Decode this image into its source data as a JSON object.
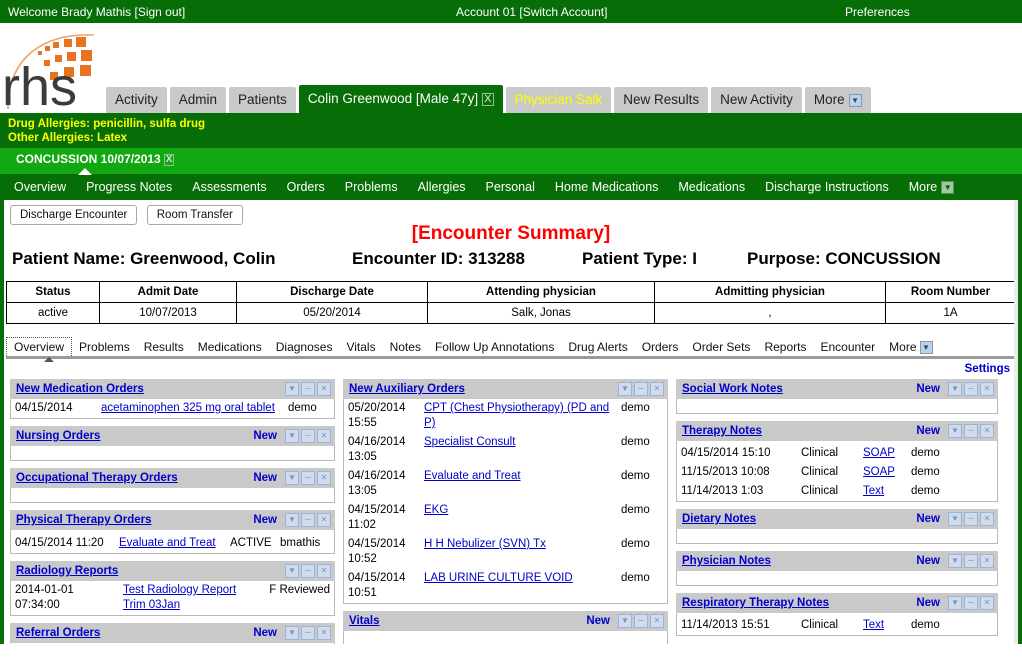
{
  "utilbar": {
    "welcome": "Welcome Brady Mathis [Sign out]",
    "account": "Account 01 [Switch Account]",
    "preferences": "Preferences"
  },
  "logo": {
    "text": "rhs"
  },
  "tabs": [
    {
      "label": "Activity",
      "state": "normal"
    },
    {
      "label": "Admin",
      "state": "normal"
    },
    {
      "label": "Patients",
      "state": "normal"
    },
    {
      "label": "Colin Greenwood [Male 47y]",
      "state": "active",
      "close": "X"
    },
    {
      "label": "Physician Salk",
      "state": "warn"
    },
    {
      "label": "New Results",
      "state": "normal"
    },
    {
      "label": "New Activity",
      "state": "normal"
    },
    {
      "label": "More",
      "state": "dropdown",
      "caret": "▼"
    }
  ],
  "allergies": {
    "drug": "Drug Allergies: penicillin, sulfa drug",
    "other": "Other Allergies: Latex"
  },
  "encounter_chip": {
    "label": "CONCUSSION 10/07/2013",
    "close": "X"
  },
  "subnav": {
    "items": [
      "Overview",
      "Progress Notes",
      "Assessments",
      "Orders",
      "Problems",
      "Allergies",
      "Personal",
      "Home Medications",
      "Medications",
      "Discharge Instructions"
    ],
    "more": "More",
    "more_caret": "▼"
  },
  "actions": {
    "discharge": "Discharge Encounter",
    "room_transfer": "Room Transfer"
  },
  "summary": {
    "title": "[Encounter Summary]",
    "patient_name": "Patient Name: Greenwood, Colin",
    "encounter_id": "Encounter ID: 313288",
    "patient_type": "Patient Type: I",
    "purpose": "Purpose: CONCUSSION"
  },
  "encounter_table": {
    "headers": [
      "Status",
      "Admit Date",
      "Discharge Date",
      "Attending physician",
      "Admitting physician",
      "Room Number"
    ],
    "row": [
      "active",
      "10/07/2013",
      "05/20/2014",
      "Salk, Jonas",
      ",",
      "1A"
    ]
  },
  "tabstrip": {
    "items": [
      "Overview",
      "Problems",
      "Results",
      "Medications",
      "Diagnoses",
      "Vitals",
      "Notes",
      "Follow Up Annotations",
      "Drug Alerts",
      "Orders",
      "Order Sets",
      "Reports",
      "Encounter"
    ],
    "more": "More",
    "more_caret": "▼",
    "selected": "Overview"
  },
  "settings_link": "Settings",
  "icons": {
    "collapse_caret": "▼",
    "minimize": "─",
    "close": "✕"
  },
  "columns": {
    "left": [
      {
        "title": "New Medication Orders",
        "new": null,
        "rows": [
          {
            "date": "04/15/2014",
            "link": "acetaminophen 325 mg oral tablet",
            "end": "demo"
          }
        ]
      },
      {
        "title": "Nursing Orders",
        "new": "New",
        "rows": []
      },
      {
        "title": "Occupational Therapy Orders",
        "new": "New",
        "rows": []
      },
      {
        "title": "Physical Therapy Orders",
        "new": "New",
        "rows": [
          {
            "date": "04/15/2014 11:20",
            "link": "Evaluate and Treat",
            "mid": "ACTIVE",
            "end": "bmathis"
          }
        ]
      },
      {
        "title": "Radiology Reports",
        "new": null,
        "rows": [
          {
            "date": "2014-01-01",
            "link": "Test Radiology Report",
            "end": "F Reviewed"
          },
          {
            "date": "07:34:00",
            "link": "Trim 03Jan",
            "end": ""
          }
        ]
      },
      {
        "title": "Referral Orders",
        "new": "New",
        "rows": []
      }
    ],
    "middle": [
      {
        "title": "New Auxiliary Orders",
        "new": null,
        "rows": [
          {
            "date": "05/20/2014 15:55",
            "link": "CPT (Chest Physiotherapy) (PD and P)",
            "end": "demo"
          },
          {
            "date": "04/16/2014 13:05",
            "link": "Specialist Consult",
            "end": "demo"
          },
          {
            "date": "04/16/2014 13:05",
            "link": "Evaluate and Treat",
            "end": "demo"
          },
          {
            "date": "04/15/2014 11:02",
            "link": "EKG",
            "end": "demo"
          },
          {
            "date": "04/15/2014 10:52",
            "link": "H H Nebulizer (SVN) Tx",
            "end": "demo"
          },
          {
            "date": "04/15/2014 10:51",
            "link": "LAB URINE CULTURE VOID",
            "end": "demo"
          }
        ]
      },
      {
        "title": "Vitals",
        "new": "New",
        "rows": []
      }
    ],
    "right": [
      {
        "title": "Social Work Notes",
        "new": "New",
        "rows": []
      },
      {
        "title": "Therapy Notes",
        "new": "New",
        "rows": [
          {
            "date": "04/15/2014 15:10",
            "type": "Clinical",
            "fmt": "SOAP",
            "end": "demo"
          },
          {
            "date": "11/15/2013 10:08",
            "type": "Clinical",
            "fmt": "SOAP",
            "end": "demo"
          },
          {
            "date": "11/14/2013 1:03",
            "type": "Clinical",
            "fmt": "Text",
            "end": "demo"
          }
        ]
      },
      {
        "title": "Dietary Notes",
        "new": "New",
        "rows": []
      },
      {
        "title": "Physician Notes",
        "new": "New",
        "rows": []
      },
      {
        "title": "Respiratory Therapy Notes",
        "new": "New",
        "rows": [
          {
            "date": "11/14/2013 15:51",
            "type": "Clinical",
            "fmt": "Text",
            "end": "demo"
          }
        ]
      }
    ]
  },
  "colors": {
    "brand_green": "#076e07",
    "bright_green": "#11a811",
    "link_blue": "#0000cc",
    "alert_red": "#ff0000",
    "allergy_yellow": "#ffff00",
    "tab_grey": "#c9c9c9"
  }
}
